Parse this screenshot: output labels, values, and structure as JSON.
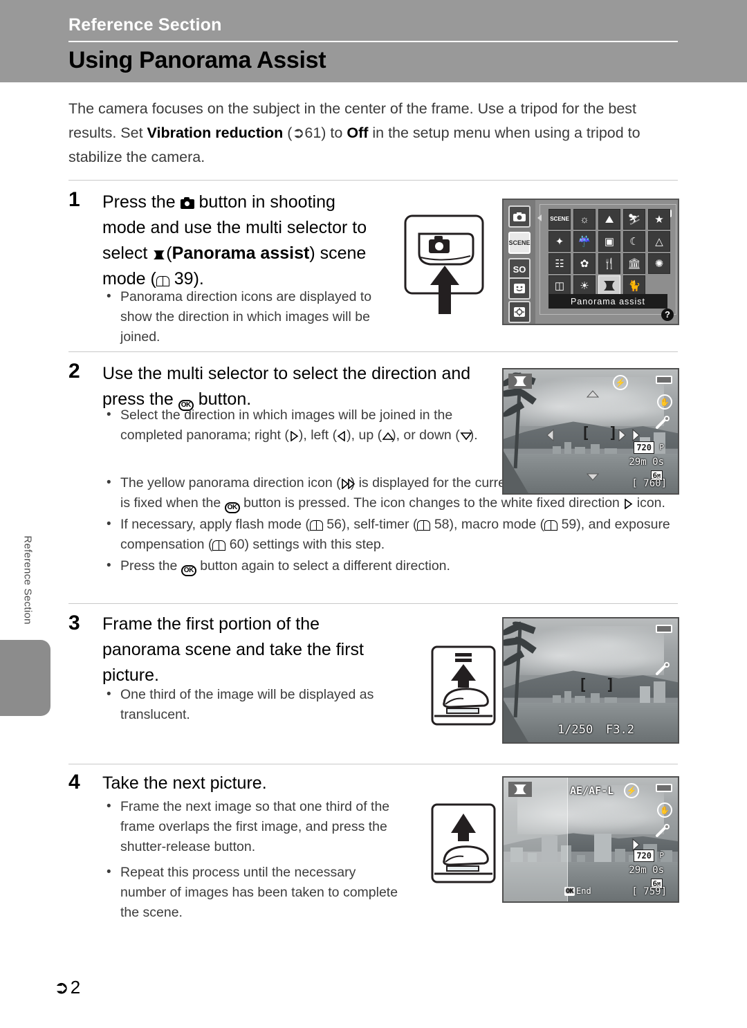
{
  "header": {
    "section_title": "Reference Section",
    "page_title": "Using Panorama Assist"
  },
  "intro": {
    "part1": "The camera focuses on the subject in the center of the frame. Use a tripod for the best results. Set ",
    "bold1": "Vibration reduction",
    "part2": " (",
    "ref1": "61",
    "part3": ") to ",
    "bold2": "Off",
    "part4": " in the setup menu when using a tripod to stabilize the camera."
  },
  "side_tab": {
    "label": "Reference Section"
  },
  "steps": [
    {
      "number": "1",
      "heading_a": "Press the ",
      "heading_b": " button in shooting mode and use the multi selector to select ",
      "heading_bold": "Panorama assist",
      "heading_c": " scene mode (",
      "heading_ref": "39",
      "heading_d": ").",
      "bullets": [
        "Panorama direction icons are displayed to show the direction in which images will be joined."
      ]
    },
    {
      "number": "2",
      "heading_a": "Use the multi selector to select the direction and press the ",
      "heading_b": " button.",
      "bullets": [
        "Select the direction in which images will be joined in the completed panorama; right (), left (), up (), or down ().",
        "The yellow panorama direction icon () is displayed for the current direction and the direction is fixed when the button is pressed. The icon changes to the white fixed direction icon.",
        "If necessary, apply flash mode (56), self-timer (58), macro mode (59), and exposure compensation (60) settings with this step.",
        "Press the button again to select a different direction."
      ],
      "refs": {
        "flash": "56",
        "selftimer": "58",
        "macro": "59",
        "expcomp": "60"
      }
    },
    {
      "number": "3",
      "heading": "Frame the first portion of the panorama scene and take the first picture.",
      "bullets": [
        "One third of the image will be displayed as translucent."
      ]
    },
    {
      "number": "4",
      "heading": "Take the next picture.",
      "bullets": [
        "Frame the next image so that one third of the frame overlaps the first image, and press the shutter-release button.",
        "Repeat this process until the necessary number of images has been taken to complete the scene."
      ]
    }
  ],
  "menu_screen": {
    "caption": "Panorama assist",
    "left_icons": [
      "camera-auto",
      "SCENE",
      "SO",
      "smile",
      "target"
    ],
    "scene_icons_row1": [
      "scene",
      "night-landscape",
      "landscape",
      "sports",
      "portrait-frame"
    ],
    "scene_icons_row2": [
      "party",
      "beach",
      "museum-frame",
      "sunset",
      "dusk"
    ],
    "scene_icons_row3": [
      "night-scene",
      "close-up",
      "food",
      "museum",
      "fireworks"
    ],
    "scene_icons_row4": [
      "copy",
      "backlight",
      "panorama-assist",
      "pet-portrait"
    ],
    "help_badge": "?",
    "selected_scene": "panorama-assist"
  },
  "lcd_step2": {
    "mode_icon": "panorama-hourglass",
    "movie_size": "720",
    "movie_size_suffix": "P",
    "time_remaining": "29m 0s",
    "image_size": "6",
    "image_size_suffix": "M",
    "frames_remaining": "[  760]",
    "direction_up": "up-triangle",
    "direction_down": "down-triangle",
    "direction_left": "left-triangle",
    "direction_right_fixed": "right-triangle",
    "direction_right_active": "right-triangle-yellow"
  },
  "lcd_step3": {
    "shutter_speed": "1/250",
    "aperture": "F3.2"
  },
  "lcd_step4": {
    "mode_icon": "panorama-hourglass",
    "ae_af_lock": "AE/AF-L",
    "movie_size": "720",
    "movie_size_suffix": "P",
    "time_remaining": "29m 0s",
    "image_size": "6",
    "image_size_suffix": "M",
    "frames_remaining": "[  759]",
    "ok_label": "OK",
    "end_label": "End"
  },
  "footer": {
    "page_number": "2"
  },
  "colors": {
    "header_band": "#999999",
    "side_tab": "#8c8c8c",
    "rule": "#c9c9c9",
    "body_text": "#3c3c3c"
  }
}
